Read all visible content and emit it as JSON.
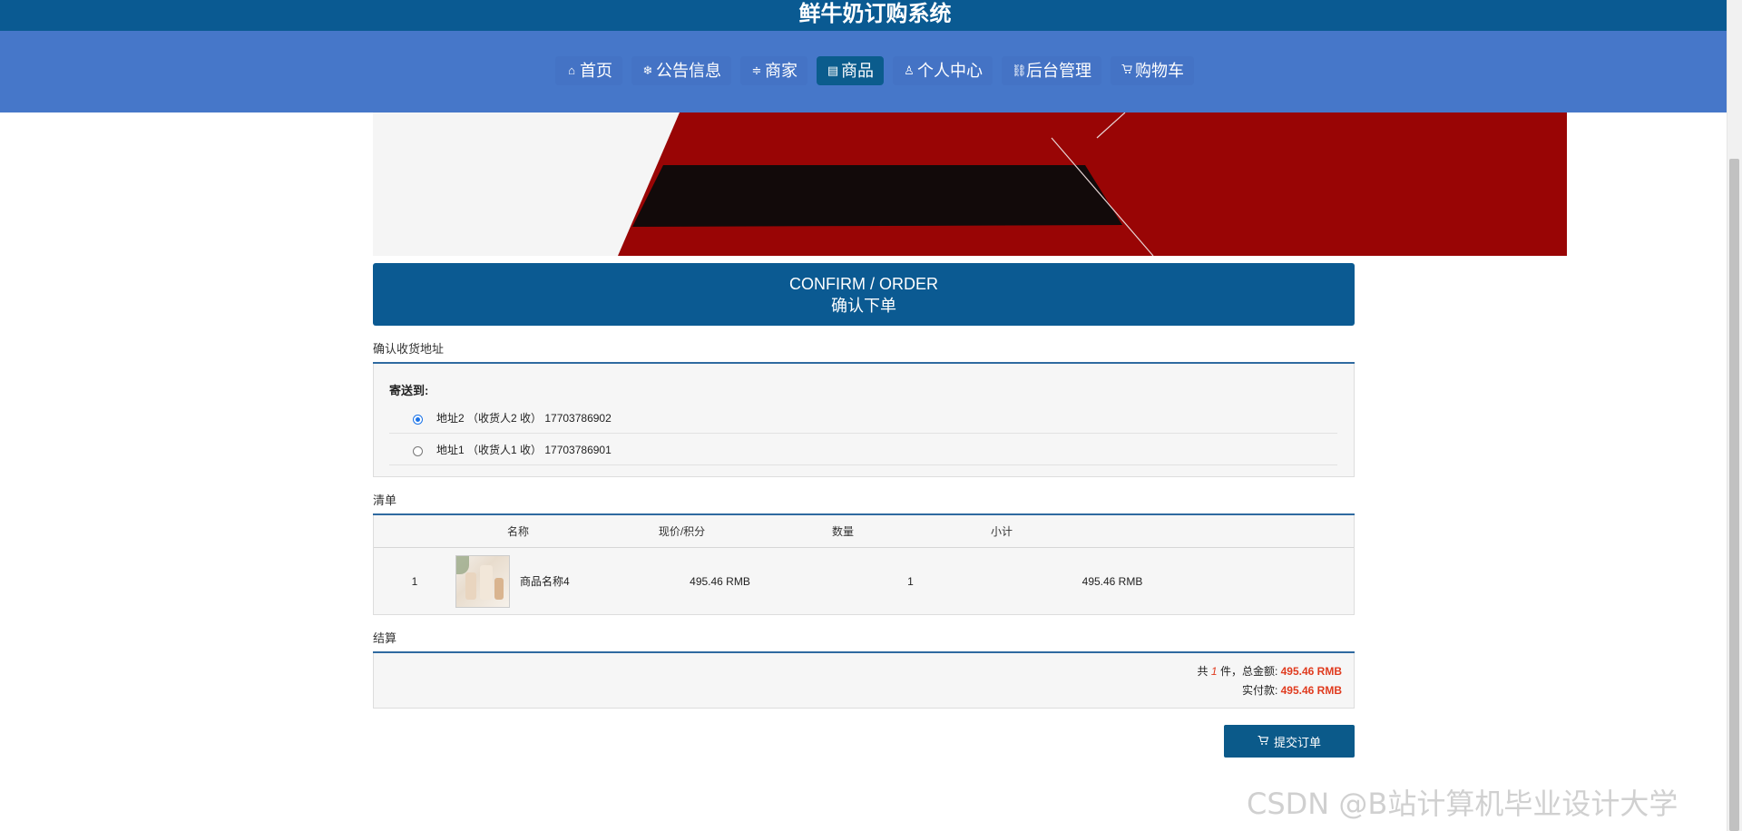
{
  "app": {
    "title": "鲜牛奶订购系统"
  },
  "nav": {
    "items": [
      {
        "label": "首页",
        "icon": "home-icon",
        "glyph": "⌂",
        "active": false
      },
      {
        "label": "公告信息",
        "icon": "snowflake-icon",
        "glyph": "❄",
        "active": false
      },
      {
        "label": "商家",
        "icon": "sliders-icon",
        "glyph": "≑",
        "active": false
      },
      {
        "label": "商品",
        "icon": "newspaper-icon",
        "glyph": "▤",
        "active": true
      },
      {
        "label": "个人中心",
        "icon": "user-icon",
        "glyph": "♙",
        "active": false
      },
      {
        "label": "后台管理",
        "icon": "link-icon",
        "glyph": "⛓",
        "active": false
      },
      {
        "label": "购物车",
        "icon": "cart-icon",
        "glyph": "🛒",
        "active": false
      }
    ]
  },
  "header": {
    "en": "CONFIRM / ORDER",
    "cn": "确认下单"
  },
  "address": {
    "section_label": "确认收货地址",
    "send_to": "寄送到:",
    "options": [
      {
        "text": "地址2 （收货人2 收） 17703786902",
        "checked": true
      },
      {
        "text": "地址1 （收货人1 收） 17703786901",
        "checked": false
      }
    ]
  },
  "list": {
    "section_label": "清单",
    "headers": {
      "name": "名称",
      "price": "现价/积分",
      "qty": "数量",
      "subtotal": "小计"
    },
    "rows": [
      {
        "index": "1",
        "name": "商品名称4",
        "price": "495.46 RMB",
        "qty": "1",
        "subtotal": "495.46 RMB"
      }
    ]
  },
  "settle": {
    "section_label": "结算",
    "line1_prefix": "共",
    "count": "1",
    "line1_mid": "件，总金额:",
    "total": "495.46 RMB",
    "line2_prefix": "实付款:",
    "paid": "495.46 RMB"
  },
  "submit": {
    "label": "提交订单",
    "icon": "cart-icon"
  },
  "watermark": "CSDN @B站计算机毕业设计大学",
  "colors": {
    "topbar": "#0a5a92",
    "navbar": "#4677c9",
    "active_tab": "#0b5c8d",
    "header": "#0b5a92",
    "price_red": "#e03b1f",
    "banner_red": "#990505"
  }
}
